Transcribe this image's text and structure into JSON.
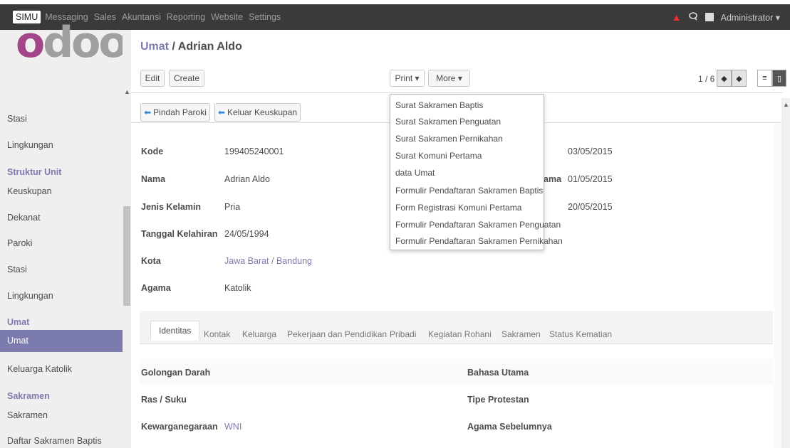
{
  "topbar": {
    "menu": [
      "SIMU",
      "Messaging",
      "Sales",
      "Akuntansi",
      "Reporting",
      "Website",
      "Settings"
    ],
    "user": "Administrator ▾",
    "icons": [
      "warning-icon",
      "chat-icon",
      "avatar-icon"
    ]
  },
  "logo": {
    "part1": "o",
    "part2": "doo"
  },
  "sidebar": {
    "items": [
      {
        "label": "Stasi",
        "type": "item"
      },
      {
        "label": "Lingkungan",
        "type": "item"
      },
      {
        "label": "Struktur Unit",
        "type": "section"
      },
      {
        "label": "Keuskupan",
        "type": "item"
      },
      {
        "label": "Dekanat",
        "type": "item"
      },
      {
        "label": "Paroki",
        "type": "item"
      },
      {
        "label": "Stasi",
        "type": "item"
      },
      {
        "label": "Lingkungan",
        "type": "item"
      },
      {
        "label": "Umat",
        "type": "section"
      },
      {
        "label": "Umat",
        "type": "active"
      },
      {
        "label": "Keluarga Katolik",
        "type": "item"
      },
      {
        "label": "Sakramen",
        "type": "section"
      },
      {
        "label": "Sakramen",
        "type": "item"
      },
      {
        "label": "Daftar Sakramen Baptis",
        "type": "item"
      }
    ]
  },
  "breadcrumb": {
    "parent": "Umat",
    "sep": " / ",
    "current": "Adrian Aldo"
  },
  "buttons": {
    "edit": "Edit",
    "create": "Create",
    "print": "Print ▾",
    "more": "More ▾",
    "pindah": "Pindah Paroki",
    "keluar": "Keluar Keuskupan"
  },
  "pager": {
    "text": "1 / 6"
  },
  "print_menu": [
    "Surat Sakramen Baptis",
    "Surat Sakramen Penguatan",
    "Surat Sakramen Pernikahan",
    "Surat Komuni Pertama",
    "data Umat",
    "Formulir Pendaftaran Sakramen Baptis",
    "Form Registrasi Komuni Pertama",
    "Formulir Pendaftaran Sakramen Penguatan",
    "Formulir Pendaftaran Sakramen Pernikahan"
  ],
  "fields": {
    "kode": {
      "label": "Kode",
      "value": "199405240001"
    },
    "nama": {
      "label": "Nama",
      "value": "Adrian Aldo"
    },
    "jk": {
      "label": "Jenis Kelamin",
      "value": "Pria"
    },
    "tgl": {
      "label": "Tanggal Kelahiran",
      "value": "24/05/1994"
    },
    "kota": {
      "label": "Kota",
      "value": "Jawa Barat / Bandung"
    },
    "agama": {
      "label": "Agama",
      "value": "Katolik"
    }
  },
  "right_fields": {
    "d1": "03/05/2015",
    "partial_label": "ama",
    "d2": "01/05/2015",
    "d3": "20/05/2015"
  },
  "tabs": [
    "Identitas",
    "Kontak",
    "Keluarga",
    "Pekerjaan dan Pendidikan",
    "Pribadi",
    "Kegiatan Rohani",
    "Sakramen",
    "Status Kematian"
  ],
  "identitas": {
    "golongan": "Golongan Darah",
    "ras": "Ras / Suku",
    "kewarganegaraan": "Kewarganegaraan",
    "kewarganegaraan_value": "WNI",
    "bahasa": "Bahasa Utama",
    "tipe": "Tipe Protestan",
    "agama_sebelumnya": "Agama Sebelumnya"
  }
}
